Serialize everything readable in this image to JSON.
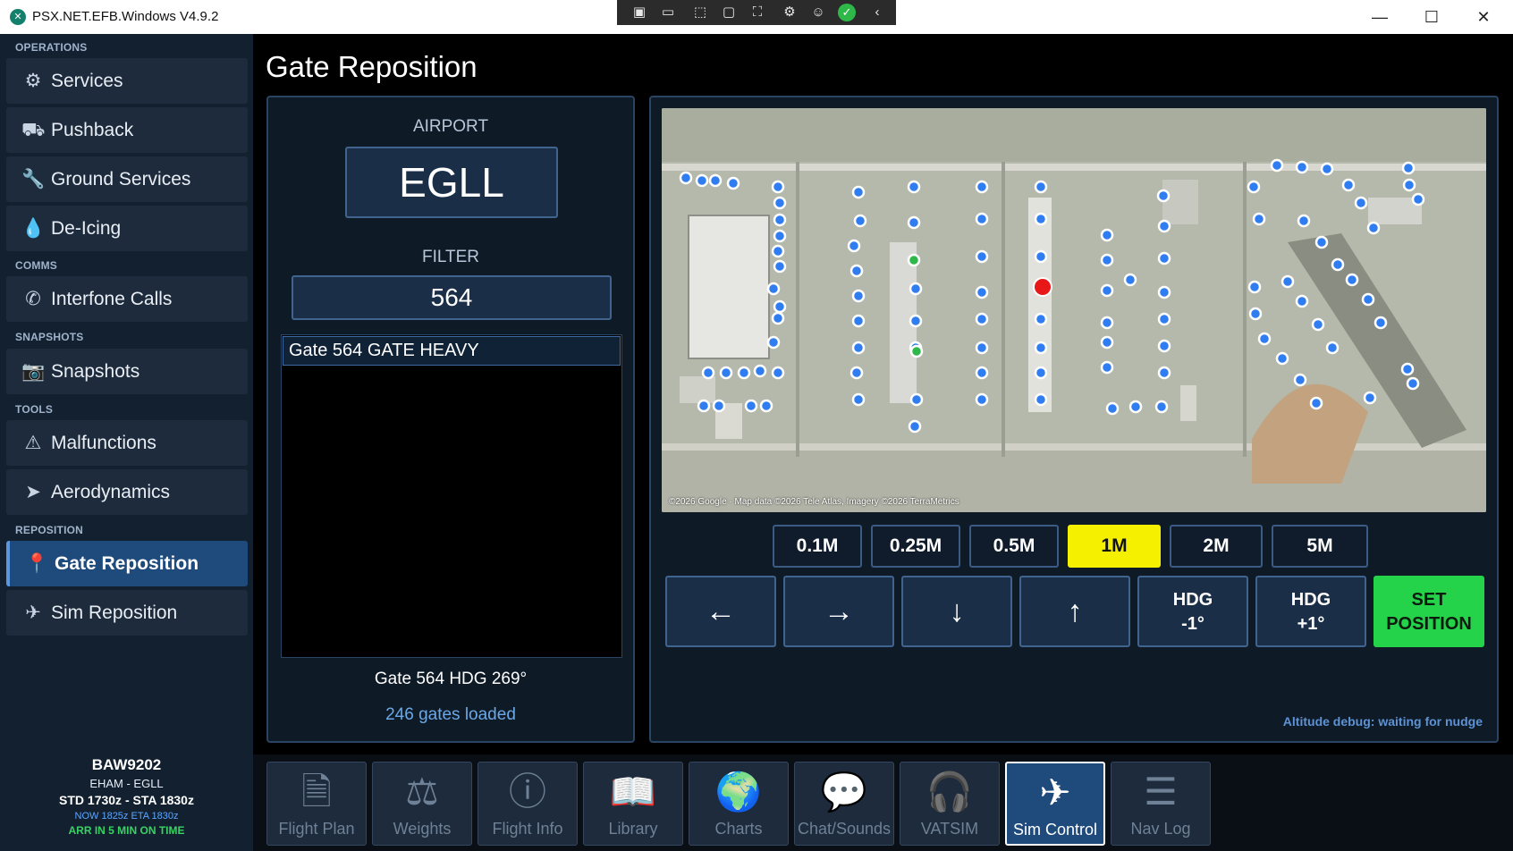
{
  "window": {
    "title": "PSX.NET.EFB.Windows V4.9.2",
    "minimize": "—",
    "maximize": "☐",
    "close": "✕"
  },
  "sidebar": {
    "sections": [
      {
        "label": "OPERATIONS",
        "items": [
          {
            "label": "Services",
            "icon": "gear-icon"
          },
          {
            "label": "Pushback",
            "icon": "truck-icon"
          },
          {
            "label": "Ground Services",
            "icon": "wrench-icon"
          },
          {
            "label": "De-Icing",
            "icon": "droplet-icon"
          }
        ]
      },
      {
        "label": "COMMS",
        "items": [
          {
            "label": "Interfone Calls",
            "icon": "phone-icon"
          }
        ]
      },
      {
        "label": "SNAPSHOTS",
        "items": [
          {
            "label": "Snapshots",
            "icon": "camera-icon"
          }
        ]
      },
      {
        "label": "TOOLS",
        "items": [
          {
            "label": "Malfunctions",
            "icon": "warning-icon"
          },
          {
            "label": "Aerodynamics",
            "icon": "paper-plane-icon"
          }
        ]
      },
      {
        "label": "REPOSITION",
        "items": [
          {
            "label": "Gate Reposition",
            "icon": "map-pin-icon",
            "active": true
          },
          {
            "label": "Sim Reposition",
            "icon": "airplane-icon"
          }
        ]
      }
    ],
    "flight": {
      "callsign": "BAW9202",
      "route": "EHAM  -  EGLL",
      "schedule": "STD 1730z  -  STA 1830z",
      "times": "NOW 1825z   ETA 1830z",
      "arrival": "ARR IN 5 MIN  ON TIME"
    }
  },
  "page": {
    "title": "Gate Reposition",
    "airport_label": "AIRPORT",
    "airport_value": "EGLL",
    "filter_label": "FILTER",
    "filter_value": "564",
    "gates": [
      "Gate 564  GATE HEAVY"
    ],
    "selected_gate_status": "Gate 564  HDG 269°",
    "gates_loaded": "246 gates loaded"
  },
  "map": {
    "credit": "©2026 Google · Map data ©2026 Tele Atlas, Imagery ©2026 TerraMetrics",
    "colors": {
      "gate": "#2f7df0",
      "selected": "#e81818",
      "occupied": "#2fb84a"
    }
  },
  "controls": {
    "scales": [
      {
        "label": "0.1M"
      },
      {
        "label": "0.25M"
      },
      {
        "label": "0.5M"
      },
      {
        "label": "1M",
        "active": true
      },
      {
        "label": "2M"
      },
      {
        "label": "5M"
      }
    ],
    "move_left": "←",
    "move_right": "→",
    "move_down": "↓",
    "move_up": "↑",
    "hdg_minus_line1": "HDG",
    "hdg_minus_line2": "-1°",
    "hdg_plus_line1": "HDG",
    "hdg_plus_line2": "+1°",
    "set_line1": "SET",
    "set_line2": "POSITION",
    "debug": "Altitude debug: waiting for nudge"
  },
  "bottom_nav": [
    {
      "label": "Flight Plan",
      "icon": "document-icon"
    },
    {
      "label": "Weights",
      "icon": "scale-icon"
    },
    {
      "label": "Flight Info",
      "icon": "info-icon"
    },
    {
      "label": "Library",
      "icon": "book-icon"
    },
    {
      "label": "Charts",
      "icon": "globe-icon"
    },
    {
      "label": "Chat/Sounds",
      "icon": "chat-icon"
    },
    {
      "label": "VATSIM",
      "icon": "headset-icon"
    },
    {
      "label": "Sim Control",
      "icon": "airplane-icon",
      "active": true
    },
    {
      "label": "Nav Log",
      "icon": "list-icon"
    }
  ]
}
